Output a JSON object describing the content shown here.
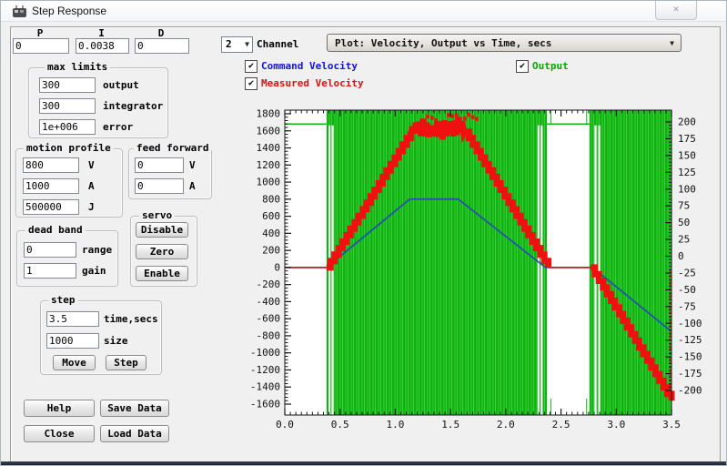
{
  "icons": {
    "check": "✔",
    "dropdown_arrow": "▼",
    "close": "✕"
  },
  "window": {
    "title": "Step Response"
  },
  "pid": {
    "p_label": "P",
    "i_label": "I",
    "d_label": "D",
    "p_value": "0",
    "i_value": "0.0038",
    "d_value": "0"
  },
  "channel": {
    "value": "2",
    "label": "Channel"
  },
  "plot_selector": {
    "value": "Plot: Velocity, Output vs Time, secs"
  },
  "legend": {
    "command_velocity": {
      "label": "Command Velocity",
      "color": "#1414d2",
      "checked": true
    },
    "measured_velocity": {
      "label": "Measured Velocity",
      "color": "#d21414",
      "checked": true
    },
    "output": {
      "label": "Output",
      "color": "#0aa20a",
      "checked": true
    }
  },
  "max_limits": {
    "title": "max limits",
    "rows": [
      {
        "value": "300",
        "label": "output"
      },
      {
        "value": "300",
        "label": "integrator"
      },
      {
        "value": "1e+006",
        "label": "error"
      }
    ]
  },
  "motion_profile": {
    "title": "motion profile",
    "rows": [
      {
        "value": "800",
        "label": "V"
      },
      {
        "value": "1000",
        "label": "A"
      },
      {
        "value": "500000",
        "label": "J"
      }
    ]
  },
  "feed_forward": {
    "title": "feed forward",
    "rows": [
      {
        "value": "0",
        "label": "V"
      },
      {
        "value": "0",
        "label": "A"
      }
    ]
  },
  "servo": {
    "title": "servo",
    "buttons": {
      "disable": "Disable",
      "zero": "Zero",
      "enable": "Enable"
    }
  },
  "dead_band": {
    "title": "dead band",
    "rows": [
      {
        "value": "0",
        "label": "range"
      },
      {
        "value": "1",
        "label": "gain"
      }
    ]
  },
  "step": {
    "title": "step",
    "rows": [
      {
        "value": "3.5",
        "label": "time,secs"
      },
      {
        "value": "1000",
        "label": "size"
      }
    ],
    "buttons": {
      "move": "Move",
      "step": "Step"
    }
  },
  "actions": {
    "help": "Help",
    "save_data": "Save Data",
    "close": "Close",
    "load_data": "Load Data"
  },
  "chart_data": {
    "type": "line",
    "title": "Plot: Velocity, Output vs Time, secs",
    "x_axis": {
      "unit": "secs",
      "range": [
        0,
        3.5
      ],
      "major_ticks": [
        0,
        0.5,
        1,
        1.5,
        2,
        2.5,
        3,
        3.5
      ],
      "minor_step": 0.05,
      "decimals": 1
    },
    "y_left_axis": {
      "range": [
        -1600,
        1800
      ],
      "major_step": 200,
      "minor_step": 40
    },
    "y_right_axis": {
      "range": [
        -200,
        200
      ],
      "major_step": 25,
      "minor_step": 5
    },
    "grid": false,
    "legend_position": "above-plot",
    "series": {
      "command_velocity": {
        "name": "Command Velocity",
        "color": "#2553ac",
        "axis": "left",
        "points": [
          [
            0,
            0
          ],
          [
            0.378,
            0
          ],
          [
            1.13,
            800
          ],
          [
            1.57,
            800
          ],
          [
            2.36,
            0
          ],
          [
            2.785,
            0
          ],
          [
            3.5,
            -750
          ]
        ]
      },
      "measured_velocity": {
        "name": "Measured Velocity",
        "color": "#f01010",
        "axis": "left",
        "flat_value_segments": [
          [
            0,
            0.378,
            0
          ],
          [
            2.385,
            2.77,
            0
          ]
        ],
        "stair_segments": [
          [
            0.378,
            1.14,
            0,
            1590
          ],
          [
            1.63,
            2.385,
            1590,
            0
          ],
          [
            2.77,
            3.5,
            0,
            -1560
          ]
        ],
        "stair_step_secs": 0.036,
        "plateau": {
          "from": 1.14,
          "to": 1.63,
          "lo": 1500,
          "hi": 1760
        },
        "top_speckles": {
          "from": 1.26,
          "to": 1.74
        },
        "right_edge_vline": {
          "x": 3.487,
          "v0": -30,
          "v1": -1500
        }
      },
      "output": {
        "name": "Output",
        "color": "#0cb40c",
        "axis": "right",
        "active_bands": [
          [
            0.378,
            2.372
          ],
          [
            2.757,
            3.5
          ]
        ],
        "quiet_level": 1680,
        "quiet_spans": [
          [
            0,
            0.378
          ],
          [
            2.372,
            2.757
          ]
        ],
        "white_stripes": [
          0.405,
          0.433,
          2.297,
          2.325,
          2.812,
          2.846
        ],
        "gap_edge_vlines": [
          2.408,
          2.732
        ]
      }
    }
  }
}
